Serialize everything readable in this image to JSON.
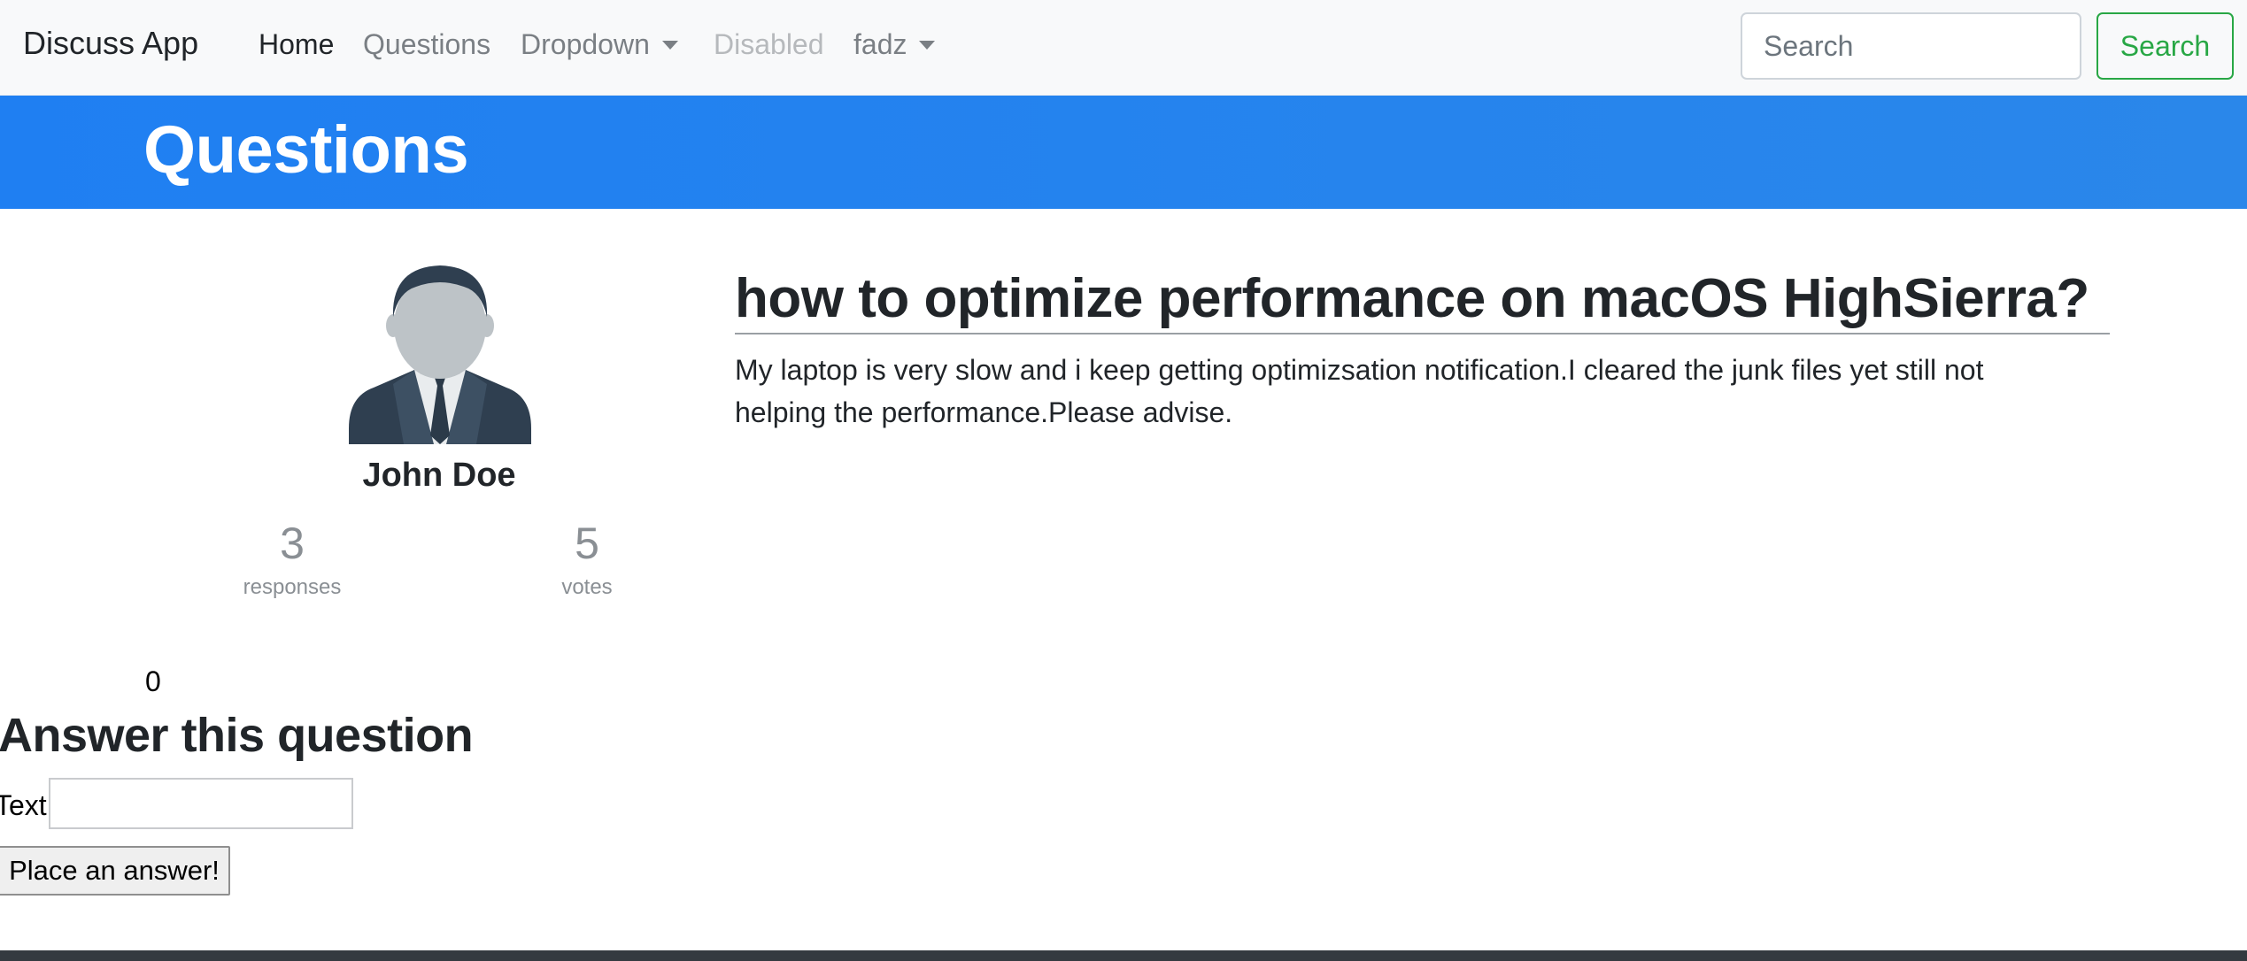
{
  "navbar": {
    "brand": "Discuss App",
    "links": [
      {
        "label": "Home",
        "active": true
      },
      {
        "label": "Questions"
      },
      {
        "label": "Dropdown",
        "dropdown": true
      },
      {
        "label": "Disabled",
        "disabled": true
      },
      {
        "label": "fadz",
        "dropdown": true
      }
    ],
    "search_placeholder": "Search",
    "search_button": "Search"
  },
  "banner": {
    "title": "Questions"
  },
  "author": {
    "avatar_icon": "user-avatar-icon",
    "name": "John Doe",
    "stats": [
      {
        "value": "3",
        "label": "responses"
      },
      {
        "value": "5",
        "label": "votes"
      }
    ]
  },
  "question": {
    "title": "how to optimize performance on macOS HighSierra?",
    "body": "My laptop is very slow and i keep getting optimizsation notification.I cleared the junk files yet still not helping the performance.Please advise."
  },
  "answer_form": {
    "count": "0",
    "heading": "Answer this question",
    "text_label": "Text",
    "text_value": "",
    "submit_label": "Place an answer!"
  },
  "colors": {
    "banner": "#1f7ff2",
    "success": "#28a745",
    "footer": "#343a40"
  }
}
